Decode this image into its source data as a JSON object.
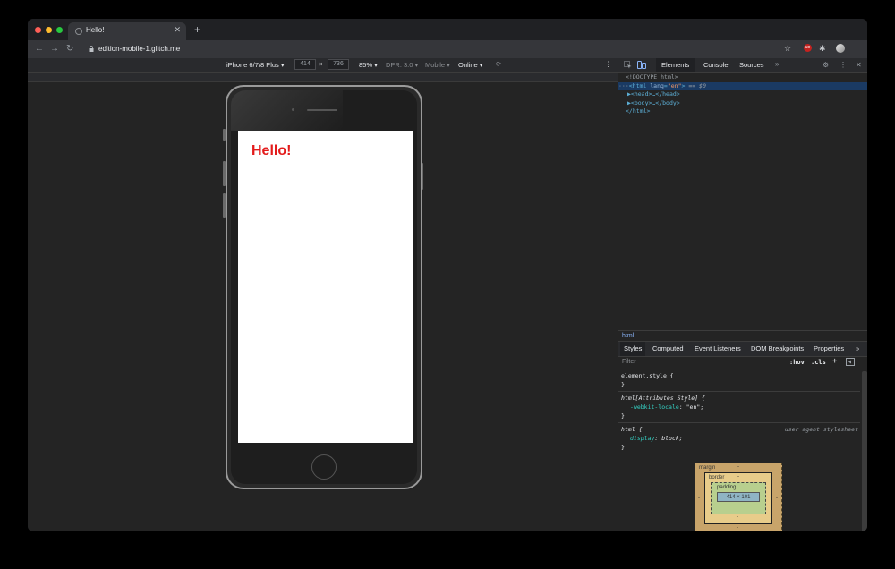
{
  "browser": {
    "tab_title": "Hello!",
    "tab_close": "✕",
    "new_tab": "+",
    "url": "edition-mobile-1.glitch.me",
    "nav": {
      "back": "←",
      "forward": "→",
      "reload": "↻",
      "lock": "🔒"
    },
    "toolbar_icons": {
      "star": "☆",
      "ext_badge": "uo",
      "puzzle": "✱",
      "menu": "⋮"
    },
    "traffic_lights": [
      "#ff5f57",
      "#febc2e",
      "#28c840"
    ]
  },
  "device_toolbar": {
    "device": "iPhone 6/7/8 Plus ▾",
    "width": "414",
    "times": "×",
    "height": "736",
    "zoom": "85% ▾",
    "dpr": "DPR: 3.0 ▾",
    "mode": "Mobile ▾",
    "throttle": "Online ▾",
    "rotate_icon": "⟳",
    "more_icon": "⋮"
  },
  "page": {
    "heading": "Hello!",
    "heading_color": "#e31b1b"
  },
  "devtools": {
    "tabs": [
      "Elements",
      "Console",
      "Sources"
    ],
    "overflow": "»",
    "settings_icon": "⚙",
    "more_icon": "⋮",
    "close_icon": "✕",
    "dom": {
      "doctype": "<!DOCTYPE html>",
      "html_open_prefix": "···",
      "html_tag_open": "<html",
      "html_attr_name": " lang",
      "html_attr_eq": "=",
      "html_attr_value": "\"en\"",
      "html_tag_close": ">",
      "html_selected_suffix": " == $0",
      "head": "▶<head>…</head>",
      "body": "▶<body>…</body>",
      "html_end": "</html>"
    },
    "breadcrumb": "html",
    "style_tabs": [
      "Styles",
      "Computed",
      "Event Listeners",
      "DOM Breakpoints",
      "Properties"
    ],
    "style_tabs_overflow": "»",
    "filter_placeholder": "Filter",
    "hov": ":hov",
    "cls": ".cls",
    "plus": "+",
    "rules": {
      "element_style": "element.style {",
      "close": "}",
      "attr_selector": "html[Attributes Style] {",
      "locale_prop": "-webkit-locale",
      "locale_value": ": \"en\";",
      "html_selector": "html {",
      "ua_label": "user agent stylesheet",
      "display_prop": "display",
      "display_value": ": block;"
    },
    "box_model": {
      "margin": "margin",
      "border": "border",
      "padding": "padding",
      "content": "414 × 101",
      "dash": "-"
    }
  }
}
